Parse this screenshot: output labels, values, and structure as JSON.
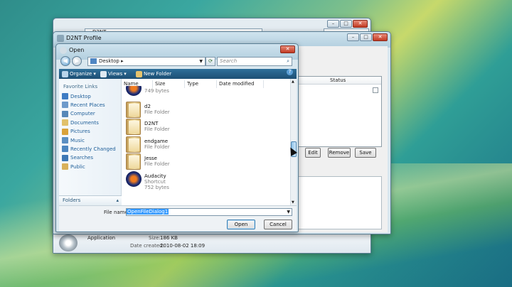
{
  "back_window": {
    "address": "D2NT",
    "details": {
      "type_value": "Application",
      "size_label": "Size:",
      "size_value": "186 KB",
      "date_label": "Date created:",
      "date_value": "2010-08-02 18:09"
    }
  },
  "profile_window": {
    "title": "D2NT Profile",
    "status_column": "Status",
    "buttons": {
      "edit": "Edit",
      "remove": "Remove",
      "save": "Save"
    }
  },
  "open_dialog": {
    "title": "Open",
    "address": "Desktop",
    "address_arrow": "▸",
    "search_placeholder": "Search",
    "toolbar": {
      "organize": "Organize",
      "views": "Views",
      "new_folder": "New Folder"
    },
    "favorites_header": "Favorite Links",
    "favorites": [
      {
        "label": "Desktop",
        "icon": "desktop-icon",
        "color": "#3e7cc4"
      },
      {
        "label": "Recent Places",
        "icon": "recent-places-icon",
        "color": "#6d9acb"
      },
      {
        "label": "Computer",
        "icon": "computer-icon",
        "color": "#5788b8"
      },
      {
        "label": "Documents",
        "icon": "documents-icon",
        "color": "#e1c16a"
      },
      {
        "label": "Pictures",
        "icon": "pictures-icon",
        "color": "#d9a23a"
      },
      {
        "label": "Music",
        "icon": "music-icon",
        "color": "#5b8fc2"
      },
      {
        "label": "Recently Changed",
        "icon": "recently-changed-icon",
        "color": "#4c86c0"
      },
      {
        "label": "Searches",
        "icon": "searches-icon",
        "color": "#3d78b5"
      },
      {
        "label": "Public",
        "icon": "public-folder-icon",
        "color": "#d8b15a"
      }
    ],
    "folders_label": "Folders",
    "columns": [
      "Name",
      "Size",
      "Type",
      "Date modified"
    ],
    "items": [
      {
        "name": "",
        "type": "749 bytes",
        "kind": "shortcut-partial"
      },
      {
        "name": "d2",
        "type": "File Folder",
        "kind": "folder"
      },
      {
        "name": "D2NT",
        "type": "File Folder",
        "kind": "folder"
      },
      {
        "name": "endgame",
        "type": "File Folder",
        "kind": "folder"
      },
      {
        "name": "Jesse",
        "type": "File Folder",
        "kind": "folder"
      },
      {
        "name": "Audacity",
        "type": "Shortcut",
        "extra": "752 bytes",
        "kind": "shortcut"
      }
    ],
    "filename_label": "File name:",
    "filename_value": "OpenFileDialog1",
    "open_button": "Open",
    "cancel_button": "Cancel"
  }
}
